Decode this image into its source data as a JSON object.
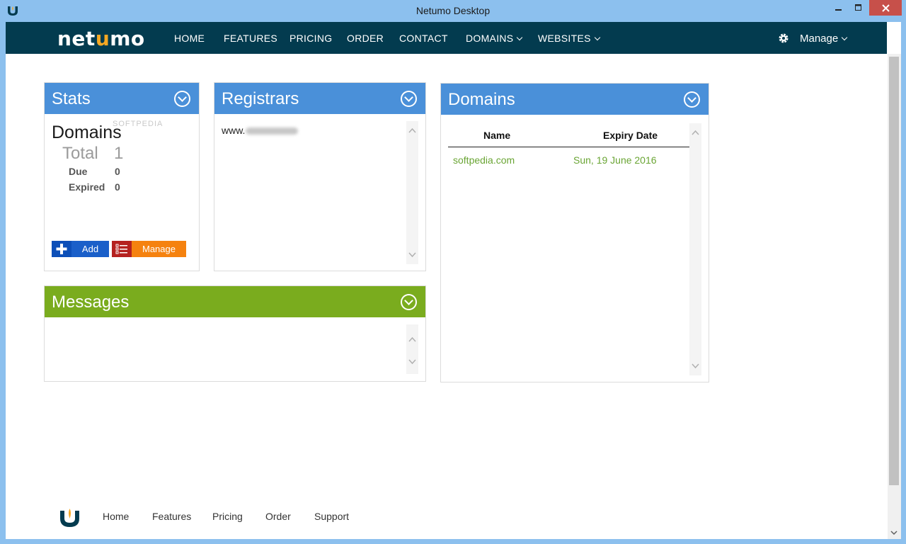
{
  "window": {
    "title": "Netumo Desktop",
    "controls": {
      "minimize": "minimize",
      "maximize": "maximize",
      "close": "close"
    }
  },
  "nav": {
    "logo_left": "net",
    "logo_u": "u",
    "logo_right": "mo",
    "links": [
      "HOME",
      "FEATURES",
      "PRICING",
      "ORDER",
      "CONTACT",
      "DOMAINS",
      "WEBSITES"
    ],
    "manage_label": "Manage"
  },
  "stats": {
    "title": "Stats",
    "heading": "Domains",
    "watermark": "SOFTPEDIA",
    "total_label": "Total",
    "total_value": "1",
    "due_label": "Due",
    "due_value": "0",
    "expired_label": "Expired",
    "expired_value": "0",
    "add_label": "Add",
    "manage_label": "Manage"
  },
  "registrars": {
    "title": "Registrars",
    "items": [
      "www."
    ]
  },
  "domains": {
    "title": "Domains",
    "columns": [
      "Name",
      "Expiry Date"
    ],
    "rows": [
      {
        "name": "softpedia.com",
        "expiry": "Sun, 19 June 2016"
      }
    ]
  },
  "messages": {
    "title": "Messages"
  },
  "footer": {
    "links": [
      "Home",
      "Features",
      "Pricing",
      "Order",
      "Support"
    ]
  },
  "colors": {
    "nav_bg": "#033b4f",
    "panel_blue": "#4a90d9",
    "panel_green": "#7aac1e",
    "accent_orange": "#f7a823",
    "domain_text": "#6aa534"
  }
}
